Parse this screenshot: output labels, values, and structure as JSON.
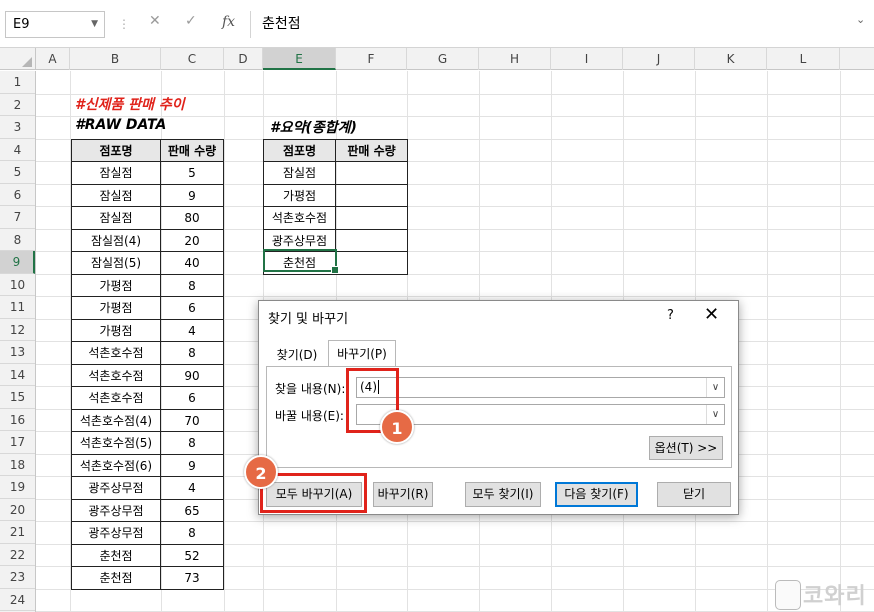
{
  "formula_bar": {
    "name_box": "E9",
    "cancel_icon": "✕",
    "enter_icon": "✓",
    "fx_label": "fx",
    "content": "춘천점"
  },
  "columns": [
    "A",
    "B",
    "C",
    "D",
    "E",
    "F",
    "G",
    "H",
    "I",
    "J",
    "K",
    "L"
  ],
  "rows": [
    "1",
    "2",
    "3",
    "4",
    "5",
    "6",
    "7",
    "8",
    "9",
    "10",
    "11",
    "12",
    "13",
    "14",
    "15",
    "16",
    "17",
    "18",
    "19",
    "20",
    "21",
    "22",
    "23",
    "24"
  ],
  "selected": {
    "column": "E",
    "row": "9"
  },
  "sheet": {
    "title_main": "#신제품 판매 추이",
    "raw_title": "#RAW DATA",
    "summary_title": "#요약(종합계)",
    "raw_table": {
      "headers": [
        "점포명",
        "판매 수량"
      ],
      "rows": [
        [
          "잠실점",
          "5"
        ],
        [
          "잠실점",
          "9"
        ],
        [
          "잠실점",
          "80"
        ],
        [
          "잠실점(4)",
          "20"
        ],
        [
          "잠실점(5)",
          "40"
        ],
        [
          "가평점",
          "8"
        ],
        [
          "가평점",
          "6"
        ],
        [
          "가평점",
          "4"
        ],
        [
          "석촌호수점",
          "8"
        ],
        [
          "석촌호수점",
          "90"
        ],
        [
          "석촌호수점",
          "6"
        ],
        [
          "석촌호수점(4)",
          "70"
        ],
        [
          "석촌호수점(5)",
          "8"
        ],
        [
          "석촌호수점(6)",
          "9"
        ],
        [
          "광주상무점",
          "4"
        ],
        [
          "광주상무점",
          "65"
        ],
        [
          "광주상무점",
          "8"
        ],
        [
          "춘천점",
          "52"
        ],
        [
          "춘천점",
          "73"
        ]
      ]
    },
    "summary_table": {
      "headers": [
        "점포명",
        "판매 수량"
      ],
      "rows": [
        [
          "잠실점",
          ""
        ],
        [
          "가평점",
          ""
        ],
        [
          "석촌호수점",
          ""
        ],
        [
          "광주상무점",
          ""
        ],
        [
          "춘천점",
          ""
        ]
      ]
    }
  },
  "dialog": {
    "title": "찾기 및 바꾸기",
    "help": "?",
    "close": "✕",
    "tabs": {
      "find": "찾기(D)",
      "replace": "바꾸기(P)"
    },
    "find_label": "찾을 내용(N):",
    "find_value": "(4)",
    "replace_label": "바꿀 내용(E):",
    "replace_value": "",
    "options_button": "옵션(T) >>",
    "buttons": {
      "replace_all": "모두 바꾸기(A)",
      "replace": "바꾸기(R)",
      "find_all": "모두 찾기(I)",
      "find_next": "다음 찾기(F)",
      "close": "닫기"
    }
  },
  "annotations": {
    "badge1": "1",
    "badge2": "2",
    "accent": "#e0231b",
    "badge_color": "#e66a45"
  },
  "watermark": "코와리"
}
